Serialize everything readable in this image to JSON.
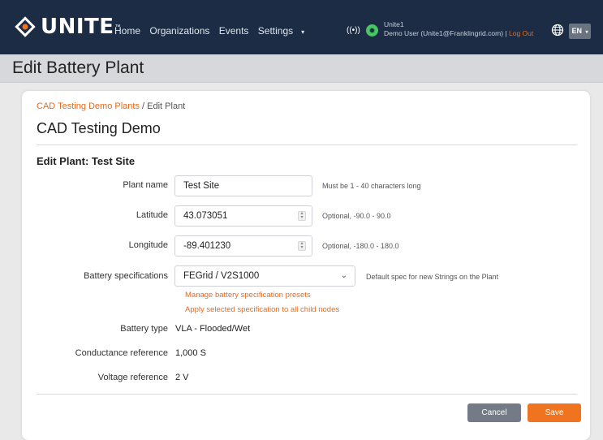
{
  "nav": {
    "brand": "UNITE",
    "brand_tm": "™",
    "links": [
      "Home",
      "Organizations",
      "Events",
      "Settings"
    ],
    "signal_glyph": "((•))",
    "device_name": "Unite1",
    "user_text": "Demo User (Unite1@Franklingrid.com) |",
    "logout": "Log Out",
    "language": "EN",
    "icons": [
      "logo-diamond-icon",
      "signal-icon",
      "status-icon",
      "globe-icon",
      "chevron-down-icon"
    ]
  },
  "page": {
    "title": "Edit Battery Plant"
  },
  "breadcrumb": {
    "parent": "CAD Testing Demo Plants",
    "separator": "/",
    "current": "Edit Plant"
  },
  "plant": {
    "name": "CAD Testing Demo"
  },
  "form": {
    "section_title": "Edit Plant: Test Site",
    "plant_name": {
      "label": "Plant name",
      "value": "Test Site",
      "hint": "Must be 1 - 40 characters long"
    },
    "latitude": {
      "label": "Latitude",
      "value": "43.073051",
      "hint": "Optional, -90.0 - 90.0"
    },
    "longitude": {
      "label": "Longitude",
      "value": "-89.401230",
      "hint": "Optional, -180.0 - 180.0"
    },
    "battery_spec": {
      "label": "Battery specifications",
      "value": "FEGrid / V2S1000",
      "hint": "Default spec for new Strings on the Plant",
      "manage_link": "Manage battery specification presets",
      "apply_link": "Apply selected specification to all child nodes"
    },
    "battery_type": {
      "label": "Battery type",
      "value": "VLA - Flooded/Wet"
    },
    "conductance_ref": {
      "label": "Conductance reference",
      "value": "1,000 S"
    },
    "voltage_ref": {
      "label": "Voltage reference",
      "value": "2 V"
    }
  },
  "buttons": {
    "cancel": "Cancel",
    "save": "Save"
  },
  "colors": {
    "navbar": "#1b2c44",
    "accent": "#f0731f",
    "link": "#e86a1a",
    "status": "#2da84a"
  }
}
